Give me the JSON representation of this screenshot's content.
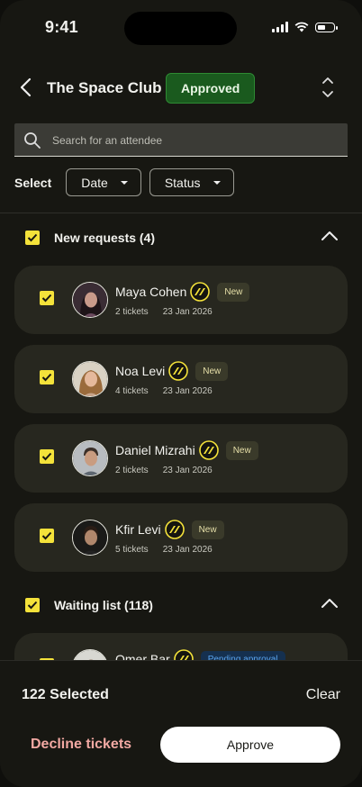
{
  "status_bar": {
    "time": "9:41"
  },
  "header": {
    "title": "The Space Club",
    "status_badge": "Approved"
  },
  "search": {
    "placeholder": "Search for an attendee",
    "value": ""
  },
  "filters": {
    "label": "Select",
    "date": "Date",
    "status": "Status"
  },
  "sections": {
    "new_requests": {
      "title": "New requests (4)"
    },
    "waiting_list": {
      "title": "Waiting list (118)"
    }
  },
  "attendees": [
    {
      "name": "Maya Cohen",
      "badge": "New",
      "tickets": "2 tickets",
      "date": "23 Jan 2026"
    },
    {
      "name": "Noa Levi",
      "badge": "New",
      "tickets": "4 tickets",
      "date": "23 Jan 2026"
    },
    {
      "name": "Daniel Mizrahi",
      "badge": "New",
      "tickets": "2 tickets",
      "date": "23 Jan 2026"
    },
    {
      "name": "Kfir Levi",
      "badge": "New",
      "tickets": "5 tickets",
      "date": "23 Jan 2026"
    }
  ],
  "waiting": [
    {
      "name": "Omer Bar",
      "badge": "Pending approval"
    }
  ],
  "footer": {
    "selected": "122 Selected",
    "clear": "Clear",
    "decline": "Decline tickets",
    "approve": "Approve"
  },
  "colors": {
    "accent": "#f4e23a",
    "approved": "#1a5a1e",
    "decline": "#f2a9a3",
    "pending": "#15304f"
  }
}
